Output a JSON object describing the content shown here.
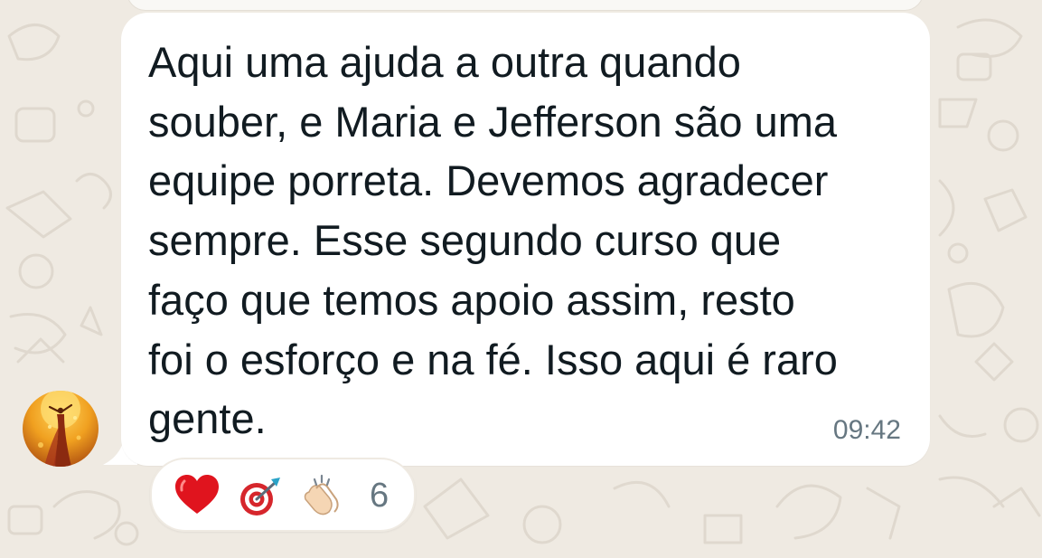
{
  "message": {
    "text": "Aqui uma ajuda a outra quando\nsouber, e Maria e Jefferson são uma\nequipe porreta. Devemos agradecer\nsempre. Esse segundo curso que\nfaço que temos apoio assim, resto\nfoi o esforço e na fé. Isso aqui é raro\ngente.",
    "time": "09:42"
  },
  "reactions": {
    "emojis": [
      "heart-icon",
      "direct-hit-icon",
      "clapping-hands-icon"
    ],
    "count": "6"
  },
  "colors": {
    "wallpaper": "#efeae2",
    "bubble": "#ffffff",
    "text": "#111b21",
    "meta": "#667781"
  }
}
